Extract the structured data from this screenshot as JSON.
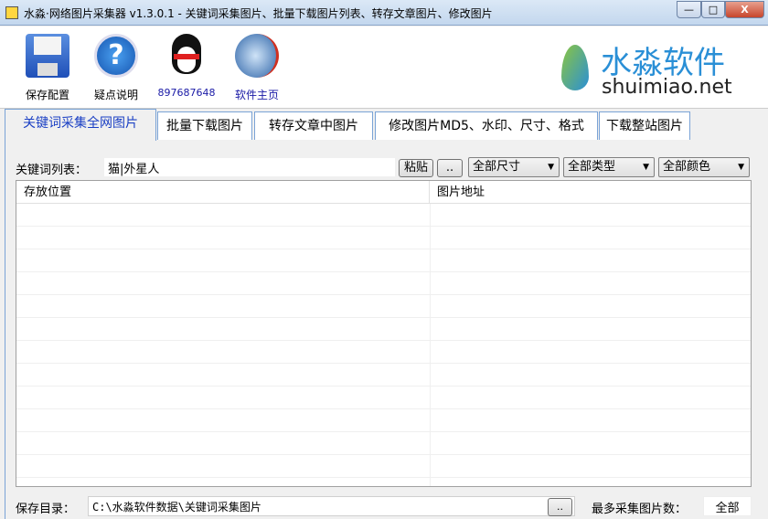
{
  "window": {
    "title": "水淼·网络图片采集器 v1.3.0.1 - 关键词采集图片、批量下载图片列表、转存文章图片、修改图片",
    "minimize": "—",
    "maximize": "□",
    "close": "X"
  },
  "toolbar": {
    "items": [
      {
        "label": "保存配置",
        "icon": "floppy-disk-icon"
      },
      {
        "label": "疑点说明",
        "icon": "help-icon"
      },
      {
        "label": "897687648",
        "icon": "qq-penguin-icon"
      },
      {
        "label": "软件主页",
        "icon": "globe-icon"
      }
    ],
    "logo": {
      "name": "水淼软件",
      "site": "shuimiao.net"
    }
  },
  "tabs": [
    "关键词采集全网图片",
    "批量下载图片",
    "转存文章中图片",
    "修改图片MD5、水印、尺寸、格式",
    "下载整站图片"
  ],
  "keyword": {
    "label": "关键词列表：",
    "value": "猫|外星人",
    "paste": "粘贴",
    "more": "..",
    "size": "全部尺寸",
    "type": "全部类型",
    "color": "全部颜色"
  },
  "table": {
    "columns": [
      "存放位置",
      "图片地址"
    ]
  },
  "footer": {
    "dir_label": "保存目录：",
    "dir_value": "C:\\水淼软件数据\\关键词采集图片",
    "browse": "..",
    "max_label": "最多采集图片数：",
    "max_value": "全部"
  },
  "colors": {
    "accent": "#1a3fc4",
    "tab_border": "#7aa3d6"
  }
}
